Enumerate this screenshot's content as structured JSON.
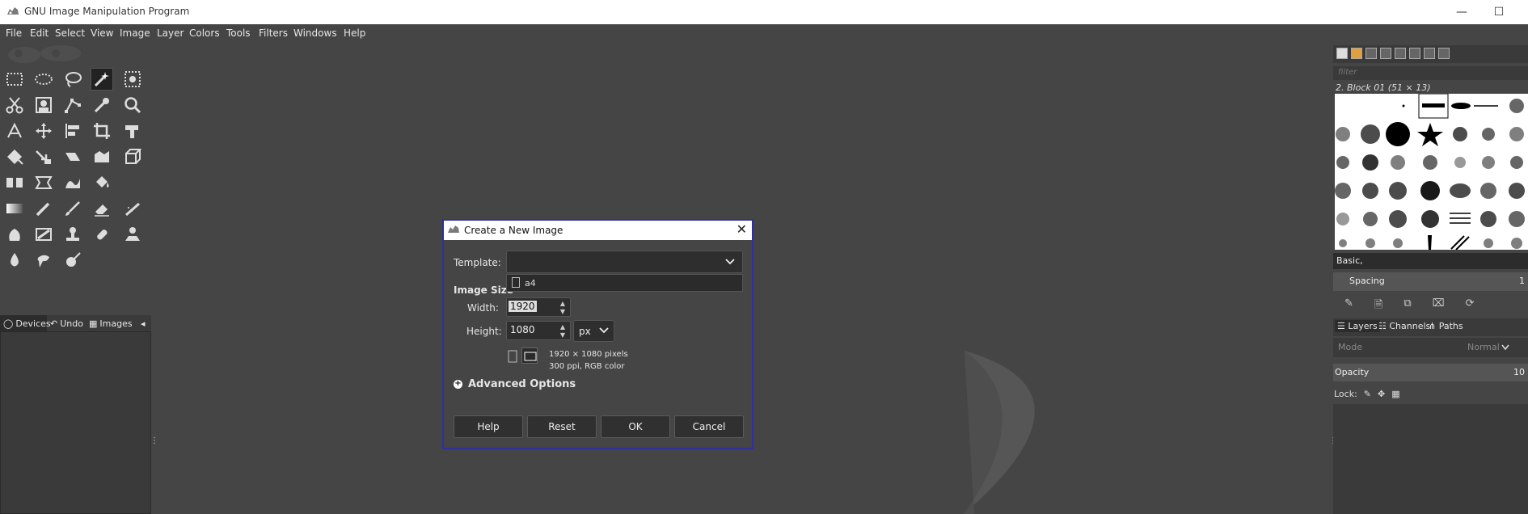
{
  "window": {
    "title": "GNU Image Manipulation Program",
    "minimize_icon": "minimize-icon",
    "maximize_icon": "maximize-icon"
  },
  "menu": [
    "File",
    "Edit",
    "Select",
    "View",
    "Image",
    "Layer",
    "Colors",
    "Tools",
    "Filters",
    "Windows",
    "Help"
  ],
  "toolbox_tabs": {
    "devices": "Devices",
    "undo": "Undo",
    "images": "Images"
  },
  "brushes": {
    "filter_placeholder": "filter",
    "selected_brush": "2. Block 01 (51 × 13)",
    "tags_value": "Basic,",
    "spacing_label": "Spacing",
    "spacing_value": "1"
  },
  "layers": {
    "tabs": {
      "layers": "Layers",
      "channels": "Channels",
      "paths": "Paths"
    },
    "mode_label": "Mode",
    "mode_value": "Normal",
    "opacity_label": "Opacity",
    "opacity_value": "10",
    "lock_label": "Lock:"
  },
  "dialog": {
    "title": "Create a New Image",
    "template_label": "Template:",
    "template_value": "",
    "template_options": [
      "a4"
    ],
    "image_size_heading": "Image Size",
    "width_label": "Width:",
    "width_value": "1920",
    "height_label": "Height:",
    "height_value": "1080",
    "unit": "px",
    "size_summary_line1": "1920 × 1080 pixels",
    "size_summary_line2": "300 ppi, RGB color",
    "advanced_options": "Advanced Options",
    "buttons": {
      "help": "Help",
      "reset": "Reset",
      "ok": "OK",
      "cancel": "Cancel"
    }
  }
}
